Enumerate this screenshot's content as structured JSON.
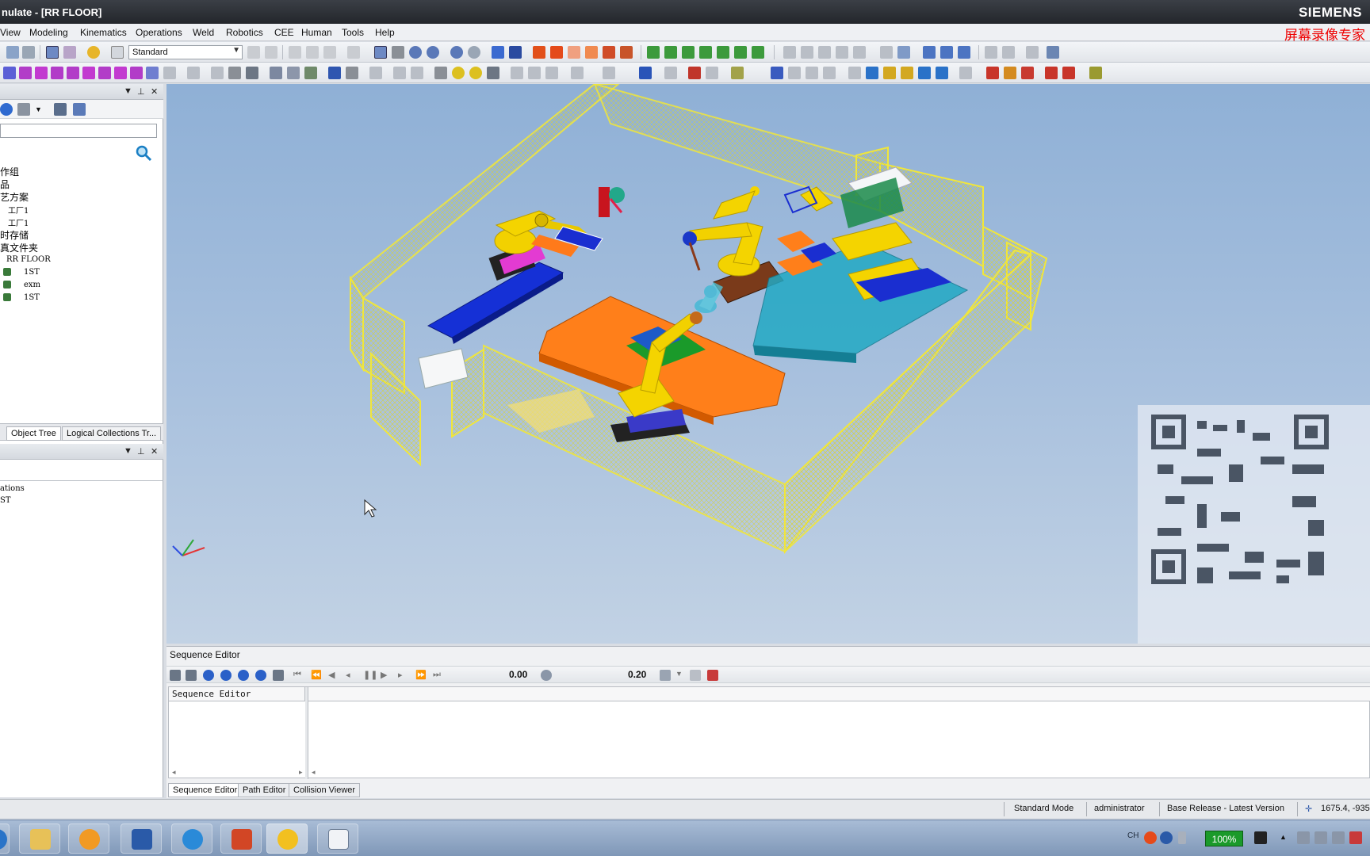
{
  "window": {
    "title": "nulate - [RR FLOOR]",
    "brand": "SIEMENS"
  },
  "watermark": {
    "text": "屏幕录像专家"
  },
  "menu": [
    "View",
    "Modeling",
    "Kinematics",
    "Operations",
    "Weld",
    "Robotics",
    "CEE",
    "Human",
    "Tools",
    "Help"
  ],
  "toolbar": {
    "layout_select": "Standard"
  },
  "object_tree": {
    "items": [
      "作组",
      "品",
      "艺方案",
      "工厂1",
      "工厂1",
      "时存储",
      "真文件夹",
      "RR FLOOR",
      "1ST",
      "exm",
      "1ST"
    ],
    "tabs": [
      "Object Tree",
      "Logical Collections Tr..."
    ]
  },
  "operations_panel": {
    "items": [
      "ations",
      "ST"
    ]
  },
  "sequence_editor": {
    "title": "Sequence Editor",
    "column_header": "Sequence Editor",
    "time_start": "0.00",
    "time_end": "0.20",
    "tabs": [
      "Sequence Editor",
      "Path Editor",
      "Collision Viewer"
    ]
  },
  "status": {
    "mode": "Standard Mode",
    "user": "administrator",
    "version": "Base Release - Latest Version",
    "coords": "1675.4, -935"
  },
  "taskbar": {
    "apps": [
      "windows-start",
      "file-explorer",
      "media-player",
      "video-recorder",
      "internet-explorer",
      "powerpoint",
      "process-simulate",
      "screen-recorder"
    ],
    "tray": {
      "lang": "CH",
      "zoom": "100%"
    }
  },
  "colors": {
    "fence": "#e8e23a",
    "robot": "#f4d400",
    "orange_table": "#ff7f1a",
    "blue_table": "#1432d8",
    "teal_table": "#21a9c4",
    "viewport_sky": "#9fb9da"
  }
}
